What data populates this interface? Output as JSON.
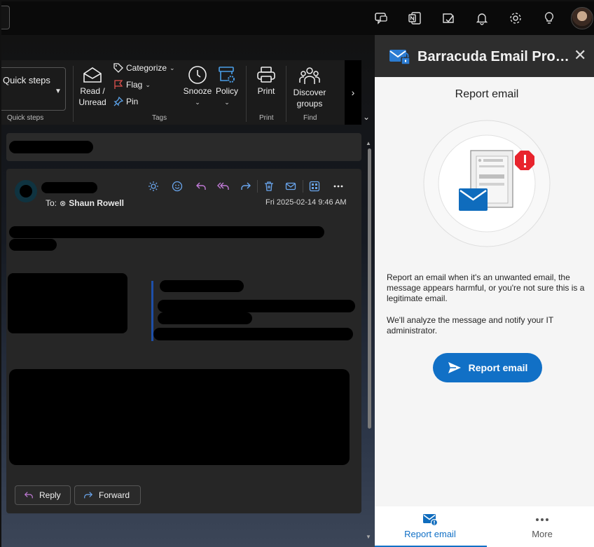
{
  "top_bar": {
    "icons": [
      "feedback-icon",
      "onenote-icon",
      "my-day-icon",
      "notifications-icon",
      "settings-icon",
      "tips-icon"
    ]
  },
  "ribbon": {
    "quick_steps_button": "Quick steps",
    "quick_steps_group": "Quick steps",
    "read_unread": [
      "Read /",
      "Unread"
    ],
    "categorize": "Categorize",
    "flag": "Flag",
    "pin": "Pin",
    "tags_group": "Tags",
    "snooze": "Snooze",
    "policy": "Policy",
    "print": "Print",
    "print_group": "Print",
    "discover_groups": [
      "Discover",
      "groups"
    ],
    "find_group": "Find"
  },
  "message": {
    "to_label": "To:",
    "to_recipient": "Shaun Rowell",
    "timestamp": "Fri 2025-02-14 9:46 AM",
    "reply_label": "Reply",
    "forward_label": "Forward"
  },
  "panel": {
    "title": "Barracuda Email Prot...",
    "heading": "Report email",
    "description": "Report an email when it's an unwanted email, the message appears harmful, or you're not sure this is a legitimate email.",
    "notice": "We'll analyze the message and notify your IT administrator.",
    "report_button": "Report email",
    "footer_tabs": [
      "Report email",
      "More"
    ]
  },
  "colors": {
    "accent_blue": "#1170c6",
    "alert_red": "#e8242d",
    "panel_header": "#2d2d2d"
  }
}
